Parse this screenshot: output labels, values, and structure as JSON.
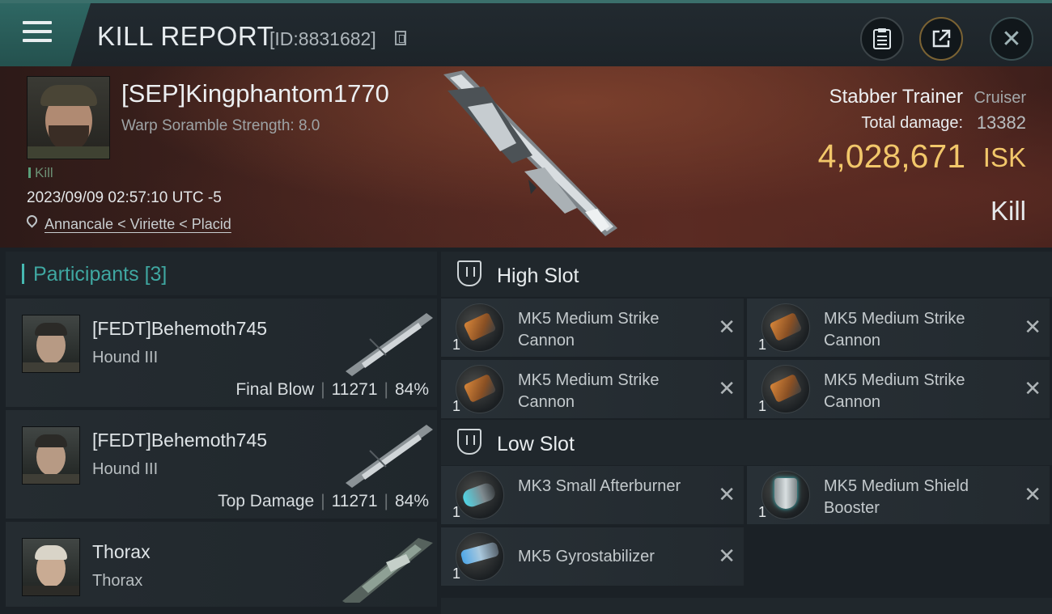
{
  "header": {
    "title": "KILL REPORT",
    "report_id": "[ID:8831682]"
  },
  "victim": {
    "name": "[SEP]Kingphantom1770",
    "sub": "Warp Soramble Strength: 8.0",
    "kill_tag": "Kill",
    "time": "2023/09/09 02:57:10 UTC -5",
    "location": "Annancale < Viriette < Placid",
    "ship_name": "Stabber Trainer",
    "ship_class": "Cruiser",
    "damage_label": "Total damage:",
    "damage_value": "13382",
    "isk_value": "4,028,671",
    "isk_unit": "ISK",
    "result": "Kill"
  },
  "participants": {
    "label": "Participants",
    "count": "[3]",
    "rows": [
      {
        "name": "[FEDT]Behemoth745",
        "ship": "Hound III",
        "role": "Final Blow",
        "damage": "11271",
        "percent": "84%"
      },
      {
        "name": "[FEDT]Behemoth745",
        "ship": "Hound III",
        "role": "Top Damage",
        "damage": "11271",
        "percent": "84%"
      },
      {
        "name": "Thorax",
        "ship": "Thorax"
      }
    ]
  },
  "fitting": {
    "high_slot": {
      "title": "High Slot",
      "modules": [
        {
          "name": "MK5 Medium Strike Cannon",
          "qty": "1"
        },
        {
          "name": "MK5 Medium Strike Cannon",
          "qty": "1"
        },
        {
          "name": "MK5 Medium Strike Cannon",
          "qty": "1"
        },
        {
          "name": "MK5 Medium Strike Cannon",
          "qty": "1"
        }
      ]
    },
    "low_slot": {
      "title": "Low Slot",
      "modules": [
        {
          "name": "MK3 Small Afterburner",
          "qty": "1"
        },
        {
          "name": "MK5 Medium Shield Booster",
          "qty": "1"
        },
        {
          "name": "MK5 Gyrostabilizer",
          "qty": "1"
        }
      ]
    },
    "close_glyph": "✕"
  },
  "colors": {
    "accent": "#3fa7a1",
    "isk": "#f2c76a",
    "menu": "#2e6763"
  }
}
